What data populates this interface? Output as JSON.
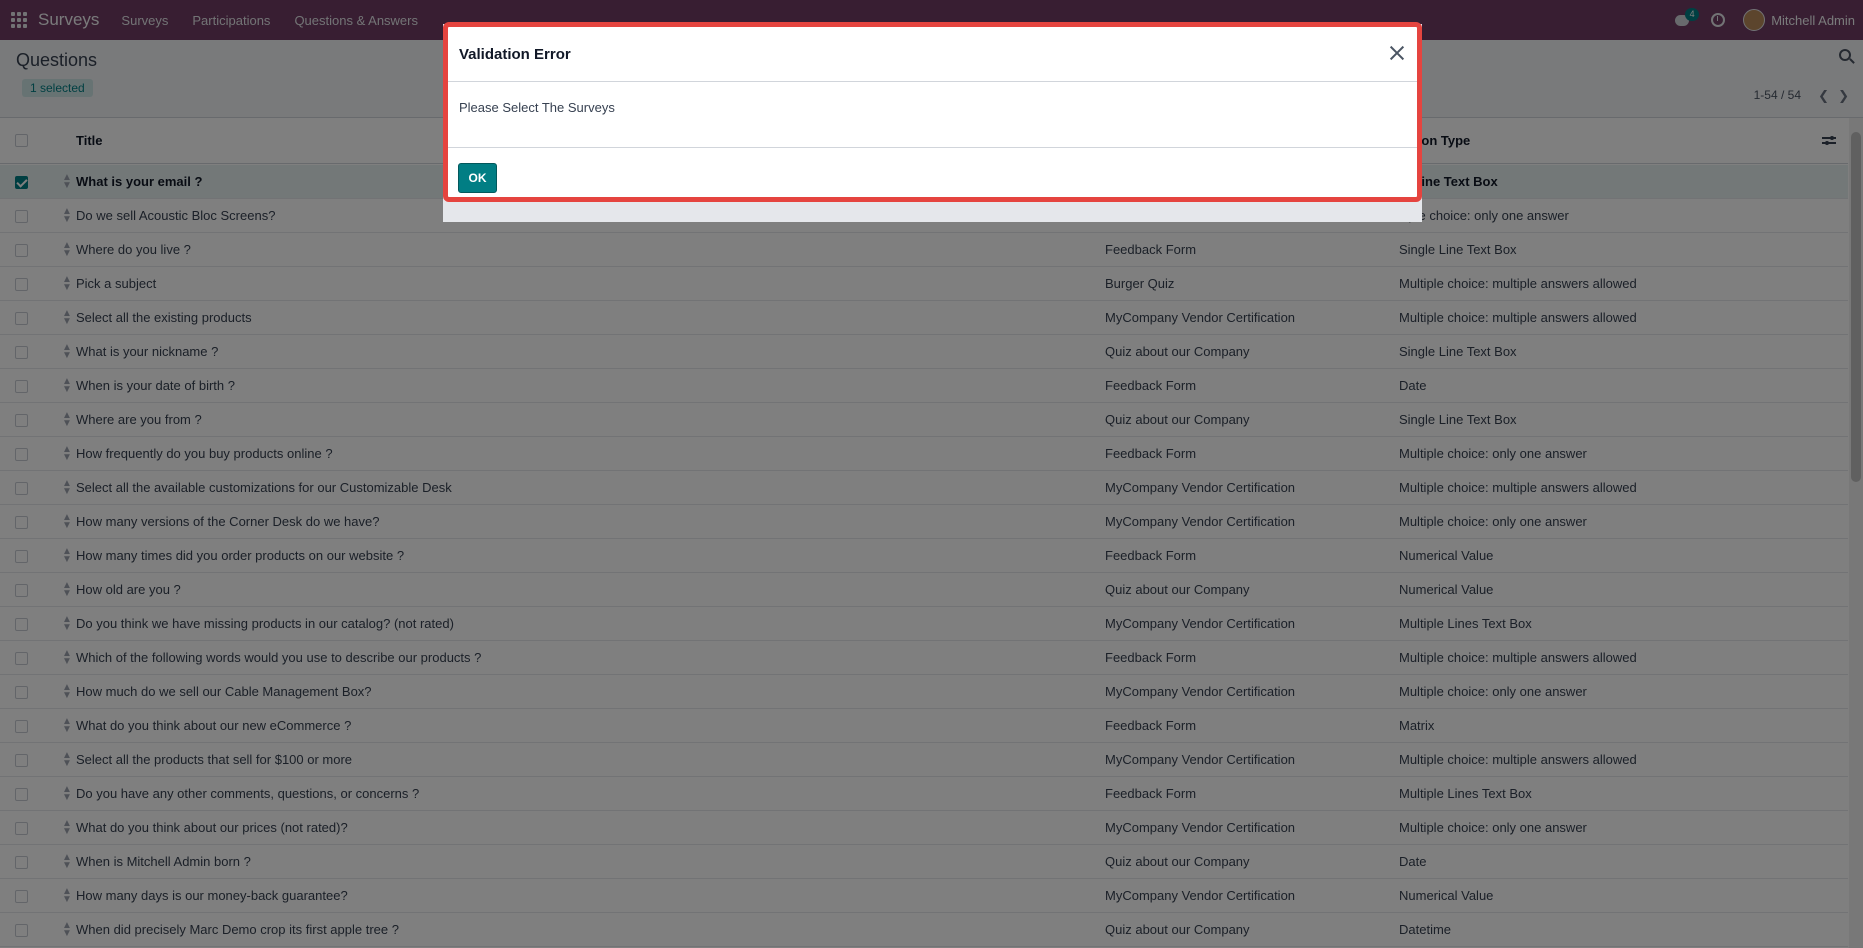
{
  "navbar": {
    "brand": "Surveys",
    "menu": [
      "Surveys",
      "Participations",
      "Questions & Answers"
    ],
    "chat_count": "4",
    "user_name": "Mitchell Admin"
  },
  "control_panel": {
    "title": "Questions",
    "selected_label": "1 selected",
    "pager": "1-54 / 54"
  },
  "table": {
    "headers": {
      "title": "Title",
      "type": "estion Type"
    },
    "rows": [
      {
        "title": "What is your email ?",
        "survey": "",
        "type": "le Line Text Box",
        "selected": true
      },
      {
        "title": "Do we sell Acoustic Bloc Screens?",
        "survey": "",
        "type": "ltiple choice: only one answer"
      },
      {
        "title": "Where do you live ?",
        "survey": "Feedback Form",
        "type": "Single Line Text Box"
      },
      {
        "title": "Pick a subject",
        "survey": "Burger Quiz",
        "type": "Multiple choice: multiple answers allowed"
      },
      {
        "title": "Select all the existing products",
        "survey": "MyCompany Vendor Certification",
        "type": "Multiple choice: multiple answers allowed"
      },
      {
        "title": "What is your nickname ?",
        "survey": "Quiz about our Company",
        "type": "Single Line Text Box"
      },
      {
        "title": "When is your date of birth ?",
        "survey": "Feedback Form",
        "type": "Date"
      },
      {
        "title": "Where are you from ?",
        "survey": "Quiz about our Company",
        "type": "Single Line Text Box"
      },
      {
        "title": "How frequently do you buy products online ?",
        "survey": "Feedback Form",
        "type": "Multiple choice: only one answer"
      },
      {
        "title": "Select all the available customizations for our Customizable Desk",
        "survey": "MyCompany Vendor Certification",
        "type": "Multiple choice: multiple answers allowed"
      },
      {
        "title": "How many versions of the Corner Desk do we have?",
        "survey": "MyCompany Vendor Certification",
        "type": "Multiple choice: only one answer"
      },
      {
        "title": "How many times did you order products on our website ?",
        "survey": "Feedback Form",
        "type": "Numerical Value"
      },
      {
        "title": "How old are you ?",
        "survey": "Quiz about our Company",
        "type": "Numerical Value"
      },
      {
        "title": "Do you think we have missing products in our catalog? (not rated)",
        "survey": "MyCompany Vendor Certification",
        "type": "Multiple Lines Text Box"
      },
      {
        "title": "Which of the following words would you use to describe our products ?",
        "survey": "Feedback Form",
        "type": "Multiple choice: multiple answers allowed"
      },
      {
        "title": "How much do we sell our Cable Management Box?",
        "survey": "MyCompany Vendor Certification",
        "type": "Multiple choice: only one answer"
      },
      {
        "title": "What do you think about our new eCommerce ?",
        "survey": "Feedback Form",
        "type": "Matrix"
      },
      {
        "title": "Select all the products that sell for $100 or more",
        "survey": "MyCompany Vendor Certification",
        "type": "Multiple choice: multiple answers allowed"
      },
      {
        "title": "Do you have any other comments, questions, or concerns ?",
        "survey": "Feedback Form",
        "type": "Multiple Lines Text Box"
      },
      {
        "title": "What do you think about our prices (not rated)?",
        "survey": "MyCompany Vendor Certification",
        "type": "Multiple choice: only one answer"
      },
      {
        "title": "When is Mitchell Admin born ?",
        "survey": "Quiz about our Company",
        "type": "Date"
      },
      {
        "title": "How many days is our money-back guarantee?",
        "survey": "MyCompany Vendor Certification",
        "type": "Numerical Value"
      },
      {
        "title": "When did precisely Marc Demo crop its first apple tree ?",
        "survey": "Quiz about our Company",
        "type": "Datetime"
      }
    ]
  },
  "dialog": {
    "title": "Validation Error",
    "message": "Please Select The Surveys",
    "ok_label": "OK"
  }
}
